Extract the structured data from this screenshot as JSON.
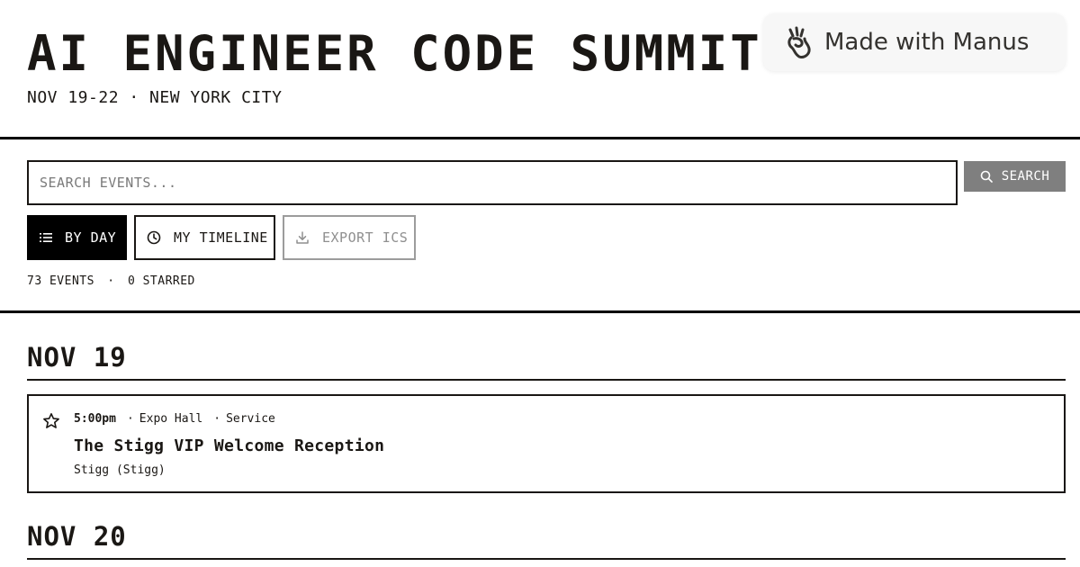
{
  "header": {
    "title": "AI ENGINEER CODE SUMMIT 2025",
    "subtitle": "NOV 19-22 · NEW YORK CITY"
  },
  "badge": {
    "label": "Made with Manus",
    "icon": "manus-hand-icon"
  },
  "search": {
    "placeholder": "SEARCH EVENTS...",
    "value": "",
    "button_label": "SEARCH",
    "icon": "search-icon"
  },
  "toolbar": {
    "by_day_label": "BY DAY",
    "my_timeline_label": "MY TIMELINE",
    "export_label": "EXPORT ICS",
    "by_day_icon": "list-icon",
    "timeline_icon": "clock-icon",
    "export_icon": "download-icon"
  },
  "counts": {
    "events": "73 EVENTS",
    "separator": "·",
    "starred": "0 STARRED"
  },
  "days": [
    {
      "label": "NOV 19",
      "events": [
        {
          "time": "5:00pm",
          "location": "Expo Hall",
          "category": "Service",
          "title": "The Stigg VIP Welcome Reception",
          "sponsor": "Stigg (Stigg)",
          "starred": false
        }
      ]
    },
    {
      "label": "NOV 20",
      "events": []
    }
  ],
  "colors": {
    "ink": "#1a1714",
    "primary_button": "#000000",
    "search_button": "#7f7f7f",
    "disabled_text": "#8f8f8f",
    "badge_bg": "#f7f7f7"
  }
}
